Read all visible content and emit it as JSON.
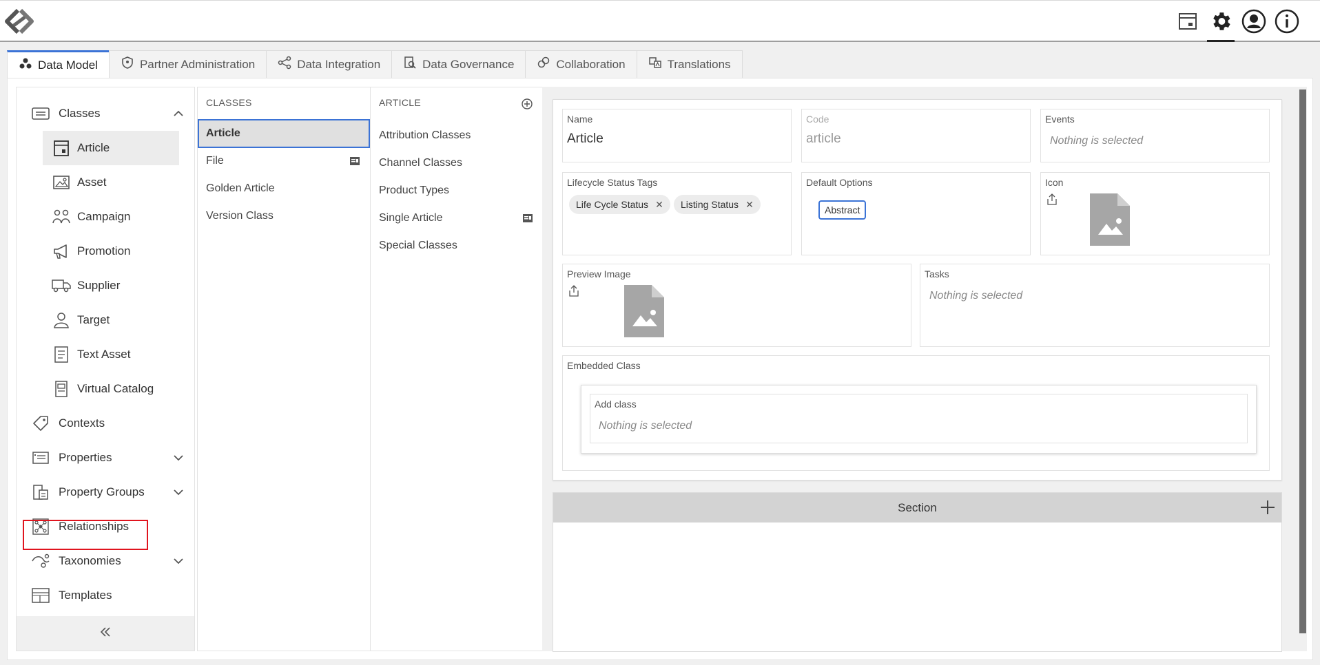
{
  "header": {
    "icons": [
      "logo-icon",
      "calendar-icon",
      "gear-icon",
      "user-icon",
      "info-icon"
    ]
  },
  "tabs": [
    {
      "label": "Data Model",
      "icon": "data-model-icon",
      "active": true
    },
    {
      "label": "Partner Administration",
      "icon": "shield-icon"
    },
    {
      "label": "Data Integration",
      "icon": "share-icon"
    },
    {
      "label": "Data Governance",
      "icon": "governance-icon"
    },
    {
      "label": "Collaboration",
      "icon": "collaboration-icon"
    },
    {
      "label": "Translations",
      "icon": "translate-icon"
    }
  ],
  "sidebar": {
    "items": [
      {
        "label": "Classes",
        "icon": "classes-icon",
        "expanded": true
      },
      {
        "label": "Article",
        "icon": "article-icon",
        "selected": true
      },
      {
        "label": "Asset",
        "icon": "asset-icon"
      },
      {
        "label": "Campaign",
        "icon": "campaign-icon"
      },
      {
        "label": "Promotion",
        "icon": "megaphone-icon"
      },
      {
        "label": "Supplier",
        "icon": "truck-icon"
      },
      {
        "label": "Target",
        "icon": "target-person-icon"
      },
      {
        "label": "Text Asset",
        "icon": "text-asset-icon"
      },
      {
        "label": "Virtual Catalog",
        "icon": "catalog-icon"
      },
      {
        "label": "Contexts",
        "icon": "tag-icon"
      },
      {
        "label": "Properties",
        "icon": "properties-icon"
      },
      {
        "label": "Property Groups",
        "icon": "property-groups-icon"
      },
      {
        "label": "Relationships",
        "icon": "relationships-icon",
        "highlighted": true
      },
      {
        "label": "Taxonomies",
        "icon": "taxonomies-icon"
      },
      {
        "label": "Templates",
        "icon": "templates-icon"
      }
    ],
    "collapse_icon": "double-chevron-left-icon"
  },
  "classes_column": {
    "header": "CLASSES",
    "items": [
      {
        "label": "Article",
        "selected": true
      },
      {
        "label": "File",
        "badge": "form-icon"
      },
      {
        "label": "Golden Article"
      },
      {
        "label": "Version Class"
      }
    ]
  },
  "article_column": {
    "header": "ARTICLE",
    "items": [
      {
        "label": "Attribution Classes"
      },
      {
        "label": "Channel Classes"
      },
      {
        "label": "Product Types"
      },
      {
        "label": "Single Article",
        "badge": "form-icon"
      },
      {
        "label": "Special Classes"
      }
    ]
  },
  "detail": {
    "name": {
      "label": "Name",
      "value": "Article"
    },
    "code": {
      "label": "Code",
      "value": "article"
    },
    "events": {
      "label": "Events",
      "placeholder": "Nothing is selected"
    },
    "lifecycle": {
      "label": "Lifecycle Status Tags",
      "tags": [
        "Life Cycle Status",
        "Listing Status"
      ]
    },
    "default_options": {
      "label": "Default Options",
      "option": "Abstract"
    },
    "icon": {
      "label": "Icon"
    },
    "preview_image": {
      "label": "Preview Image"
    },
    "tasks": {
      "label": "Tasks",
      "placeholder": "Nothing is selected"
    },
    "embedded_class": {
      "label": "Embedded Class",
      "add_label": "Add class",
      "placeholder": "Nothing is selected"
    },
    "section": {
      "title": "Section"
    }
  },
  "colors": {
    "accent": "#3b73d6",
    "highlight": "#e0141e"
  }
}
